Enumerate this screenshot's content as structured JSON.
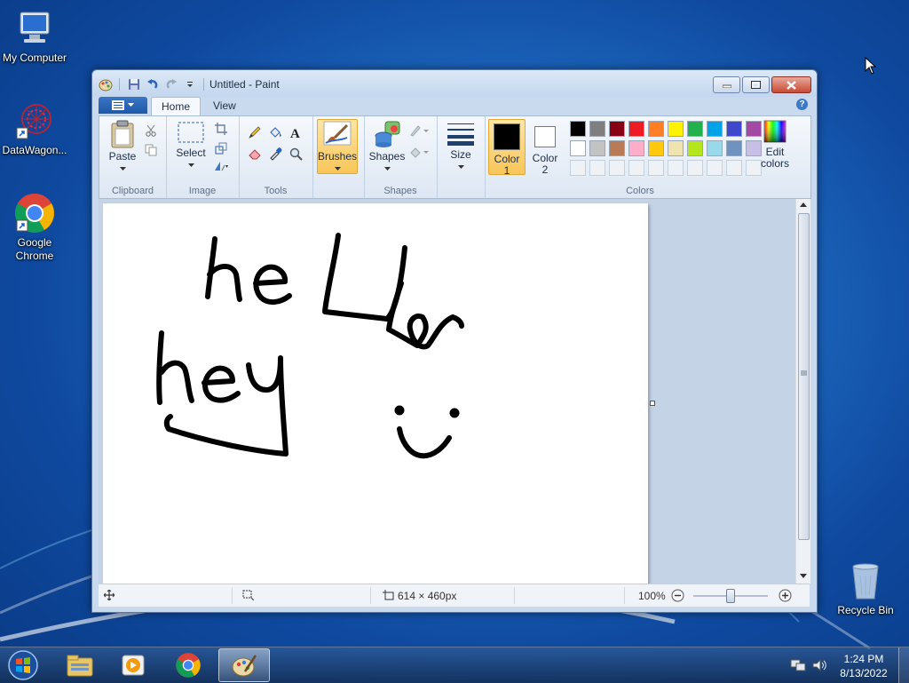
{
  "desktop": {
    "icons": [
      {
        "label": "My Computer",
        "icon": "computer-icon"
      },
      {
        "label": "DataWagon...",
        "icon": "datawagon-icon"
      },
      {
        "label": "Google Chrome",
        "icon": "chrome-icon"
      },
      {
        "label": "Recycle Bin",
        "icon": "recycle-bin-icon"
      }
    ]
  },
  "window": {
    "title": "Untitled - Paint"
  },
  "ribbon": {
    "tabs": [
      {
        "label": "Home",
        "active": true
      },
      {
        "label": "View",
        "active": false
      }
    ],
    "groups": {
      "clipboard": {
        "label": "Clipboard",
        "paste": "Paste"
      },
      "image": {
        "label": "Image",
        "select": "Select"
      },
      "tools": {
        "label": "Tools"
      },
      "brushes": {
        "label": "Brushes"
      },
      "shapes": {
        "label": "Shapes",
        "button": "Shapes"
      },
      "size": {
        "label": "Size"
      },
      "colors": {
        "label": "Colors",
        "color1": "Color\n1",
        "color1_value": "#000000",
        "color2": "Color\n2",
        "color2_value": "#ffffff",
        "edit": "Edit\ncolors",
        "palette": [
          "#000000",
          "#7f7f7f",
          "#880015",
          "#ed1c24",
          "#ff7f27",
          "#fff200",
          "#22b14c",
          "#00a2e8",
          "#3f48cc",
          "#a349a4",
          "#ffffff",
          "#c3c3c3",
          "#b97a57",
          "#ffaec9",
          "#ffc90e",
          "#efe4b0",
          "#b5e61d",
          "#99d9ea",
          "#7092be",
          "#c8bfe7"
        ]
      }
    }
  },
  "canvas": {
    "drawing_text": [
      "hello",
      "hey"
    ],
    "size": "614 × 460px"
  },
  "status": {
    "dimensions": "614 × 460px",
    "zoom": "100%"
  },
  "taskbar": {
    "items": [
      "start-orb-icon",
      "explorer-icon",
      "media-player-icon",
      "chrome-icon",
      "paint-icon"
    ],
    "time": "1:24 PM",
    "date": "8/13/2022"
  }
}
